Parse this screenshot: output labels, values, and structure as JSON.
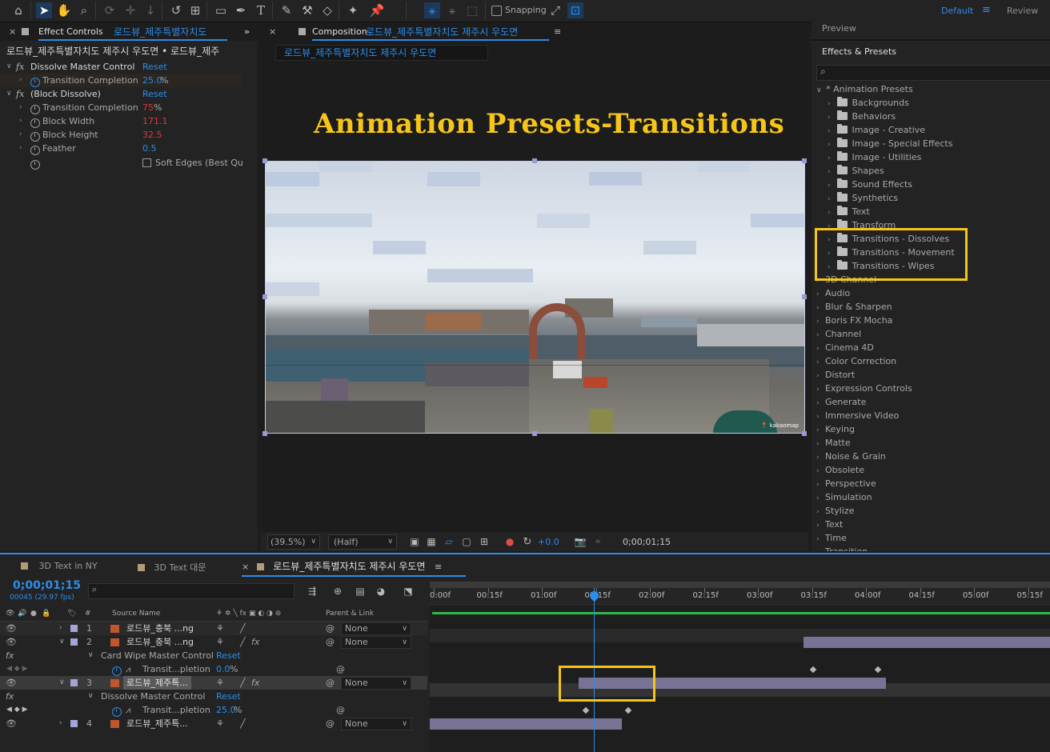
{
  "toolbar": {
    "snapping_label": "Snapping",
    "workspace_default": "Default",
    "workspace_review": "Review"
  },
  "effect_controls": {
    "tab_label": "Effect Controls",
    "tab_target": "로드뷰_제주특별자치도",
    "subtitle": "로드뷰_제주특별자치도 제주시 우도면 • 로드뷰_제주",
    "effects": [
      {
        "name": "Dissolve Master Control",
        "reset": "Reset",
        "props": [
          {
            "name": "Transition Completion",
            "value": "25.0",
            "unit": "%"
          }
        ]
      },
      {
        "name": "(Block Dissolve)",
        "reset": "Reset",
        "props": [
          {
            "name": "Transition Completion",
            "value": "75",
            "unit": "%"
          },
          {
            "name": "Block Width",
            "value": "171.1",
            "unit": ""
          },
          {
            "name": "Block Height",
            "value": "32.5",
            "unit": ""
          },
          {
            "name": "Feather",
            "value": "0.5",
            "unit": ""
          }
        ]
      }
    ],
    "soft_edges_label": "Soft Edges (Best Qu"
  },
  "composition": {
    "tab_label": "Composition",
    "tab_target": "로드뷰_제주특별자치도 제주시 우도면",
    "breadcrumb": "로드뷰_제주특별자치도 제주시 우도면",
    "overlay_title": "Animation Presets-Transitions",
    "watermark": "kakaomap",
    "zoom": "(39.5%)",
    "resolution": "(Half)",
    "exposure": "+0.0",
    "timecode": "0;00;01;15"
  },
  "effects_presets": {
    "preview_label": "Preview",
    "panel_title": "Effects & Presets",
    "search_placeholder": "",
    "root": "* Animation Presets",
    "preset_folders": [
      "Backgrounds",
      "Behaviors",
      "Image - Creative",
      "Image - Special Effects",
      "Image - Utilities",
      "Shapes",
      "Sound Effects",
      "Synthetics",
      "Text",
      "Transform",
      "Transitions - Dissolves",
      "Transitions - Movement",
      "Transitions - Wipes"
    ],
    "categories": [
      "3D Channel",
      "Audio",
      "Blur & Sharpen",
      "Boris FX Mocha",
      "Channel",
      "Cinema 4D",
      "Color Correction",
      "Distort",
      "Expression Controls",
      "Generate",
      "Immersive Video",
      "Keying",
      "Matte",
      "Noise & Grain",
      "Obsolete",
      "Perspective",
      "Simulation",
      "Stylize",
      "Text",
      "Time",
      "Transition"
    ]
  },
  "timeline": {
    "tabs": [
      {
        "label": "3D Text in NY",
        "color": "#b39b75"
      },
      {
        "label": "3D Text 대문",
        "color": "#b39b75"
      },
      {
        "label": "로드뷰_제주특별자치도 제주시 우도면",
        "color": "#b39b75"
      }
    ],
    "timecode": "0;00;01;15",
    "frame_info": "00045 (29.97 fps)",
    "col_source_name": "Source Name",
    "col_parent": "Parent & Link",
    "col_hash": "#",
    "ruler": [
      "0:00f",
      "00:15f",
      "01:00f",
      "01:15f",
      "02:00f",
      "02:15f",
      "03:00f",
      "03:15f",
      "04:00f",
      "04:15f",
      "05:00f",
      "05:15f"
    ],
    "current_time_seconds": 1.5,
    "layers": [
      {
        "num": "1",
        "name": "로드뷰_충북 ...ng",
        "parent": "None",
        "start": 0,
        "end": 0
      },
      {
        "num": "2",
        "name": "로드뷰_충북 ...ng",
        "parent": "None",
        "start": 3.46,
        "end": 5.76
      },
      {
        "num": "3",
        "name": "로드뷰_제주특...",
        "parent": "None",
        "start": 1.38,
        "end": 4.22
      },
      {
        "num": "4",
        "name": "로드뷰_제주특...",
        "parent": "None",
        "start": 0,
        "end": 1.78
      }
    ],
    "sub_layer_2": {
      "effect": "Card Wipe Master Control",
      "reset": "Reset",
      "prop": "Transit...pletion",
      "value": "0.0",
      "unit": "%"
    },
    "sub_layer_3": {
      "effect": "Dissolve Master Control",
      "reset": "Reset",
      "prop": "Transit...pletion",
      "value": "25.0",
      "unit": "%"
    }
  }
}
